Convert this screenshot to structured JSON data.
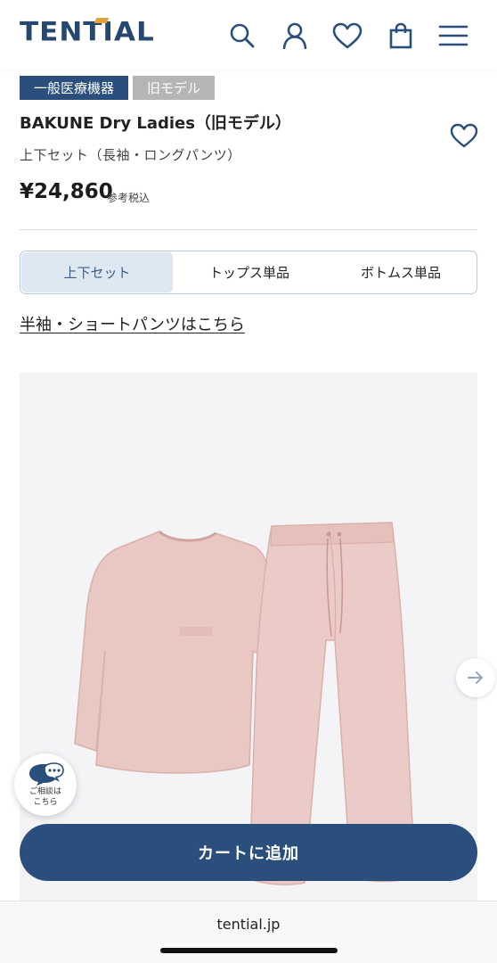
{
  "header": {
    "logo": "TENTIAL",
    "icons": [
      "search-icon",
      "account-icon",
      "heart-icon",
      "bag-icon",
      "menu-icon"
    ]
  },
  "product": {
    "tags": [
      "一般医療機器",
      "旧モデル"
    ],
    "title": "BAKUNE Dry Ladies（旧モデル）",
    "subtitle": "上下セット（長袖・ロングパンツ）",
    "price": "¥24,860",
    "tax_note": "参考税込"
  },
  "variants": {
    "options": [
      "上下セット",
      "トップス単品",
      "ボトムス単品"
    ],
    "selected": "上下セット"
  },
  "alt_link": "半袖・ショートパンツはこちら",
  "chat": {
    "label_line1": "ご相談は",
    "label_line2": "こちら"
  },
  "cart_button": "カートに追加",
  "browser": {
    "url": "tential.jp"
  },
  "colors": {
    "brand_navy": "#2b4f7d",
    "accent_orange": "#e6a23a",
    "garment_pink": "#e9c7c3",
    "segment_active_bg": "#dde8f3"
  }
}
